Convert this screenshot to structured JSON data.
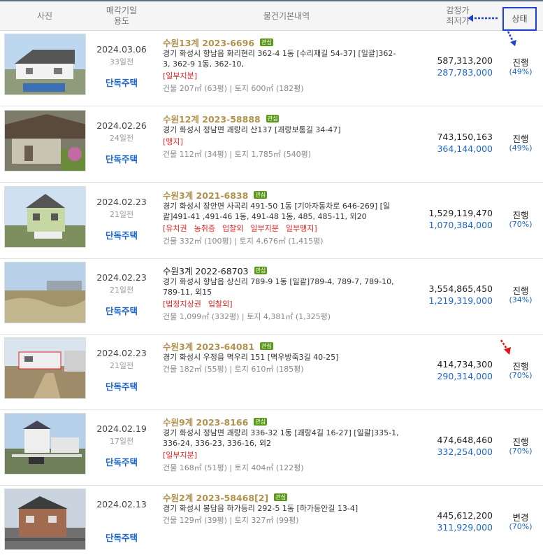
{
  "header": {
    "photo": "사진",
    "date_l1": "매각기일",
    "date_l2": "용도",
    "info": "물건기본내역",
    "price_l1": "감정가",
    "price_l2": "최저가",
    "status": "상태"
  },
  "colors": {
    "accent": "#1e66c9",
    "case_gold": "#b0924e",
    "warn_red": "#e02424",
    "badge_green": "#5b9a17",
    "status_box": "#1f3fd9"
  },
  "rows": [
    {
      "photo_icon": "house-photo",
      "date": "2024.03.06",
      "days": "33일전",
      "usage": "단독주택",
      "case": "수원13계 2023-6696",
      "badge": "관심",
      "addr1": "경기 화성시 향남읍 화리현리 362-4 1동 [수리재길 54-37]  [일괄]362-",
      "addr2": "3, 362-9 1동, 362-10,",
      "tags": [
        "[일부지분]"
      ],
      "area": "건물 207㎡ (63평)   |   토지 600㎡ (182평)",
      "appraise": "587,313,200",
      "min": "287,783,000",
      "status": "진행",
      "pct": "(49%)"
    },
    {
      "photo_icon": "house-photo",
      "date": "2024.02.26",
      "days": "24일전",
      "usage": "단독주택",
      "case": "수원12계 2023-58888",
      "badge": "관심",
      "addr1": "경기 화성시 정남면 괘랑리 산137 [괘랑보통길 34-47]",
      "addr2": "",
      "tags": [
        "[맹지]"
      ],
      "area": "건물 112㎡ (34평)   |   토지 1,785㎡ (540평)",
      "appraise": "743,150,163",
      "min": "364,144,000",
      "status": "진행",
      "pct": "(49%)"
    },
    {
      "photo_icon": "house-photo",
      "date": "2024.02.23",
      "days": "21일전",
      "usage": "단독주택",
      "case": "수원3계 2021-6838",
      "badge": "관심",
      "addr1": "경기 화성시 장안면 사곡리 491-50 1동 [기아자동차로 646-269]  [일",
      "addr2": "괄]491-41 ,491-46 1동, 491-48 1동, 485, 485-11, 외20",
      "tags": [
        "[유치권",
        "농취증",
        "입찰외",
        "일부지분",
        "일부맹지]"
      ],
      "area": "건물 332㎡ (100평)   |   토지 4,676㎡ (1,415평)",
      "appraise": "1,529,119,470",
      "min": "1,070,384,000",
      "status": "진행",
      "pct": "(70%)"
    },
    {
      "photo_icon": "land-photo",
      "date": "2024.02.23",
      "days": "21일전",
      "usage": "단독주택",
      "case": "수원3계 2022-68703",
      "badge": "관심",
      "case_dark": true,
      "addr1": "경기 화성시 향남읍 상신리 789-9 1동  [일괄]789-4, 789-7, 789-10,",
      "addr2": "789-11, 외15",
      "tags": [
        "[법정지상권",
        "입찰외]"
      ],
      "area": "건물 1,099㎡ (332평)   |   토지 4,381㎡ (1,325평)",
      "appraise": "3,554,865,450",
      "min": "1,219,319,000",
      "status": "진행",
      "pct": "(34%)"
    },
    {
      "photo_icon": "house-photo",
      "date": "2024.02.23",
      "days": "21일전",
      "usage": "단독주택",
      "case": "수원3계 2023-64081",
      "badge": "관심",
      "addr1": "경기 화성시 우정읍 멱우리 151 [멱우방죽3길 40-25]",
      "addr2": "",
      "tags": [],
      "area": "건물 182㎡ (55평)   |   토지 610㎡ (185평)",
      "appraise": "414,734,300",
      "min": "290,314,000",
      "status": "진행",
      "pct": "(70%)"
    },
    {
      "photo_icon": "house-photo",
      "date": "2024.02.19",
      "days": "17일전",
      "usage": "단독주택",
      "case": "수원9계 2023-8166",
      "badge": "관심",
      "addr1": "경기 화성시 정남면 괘랑리 336-32 1동 [괘랑4길 16-27]  [일괄]335-1,",
      "addr2": "336-24, 336-23, 336-16, 외2",
      "tags": [
        "[일부지분]"
      ],
      "area": "건물 168㎡ (51평)   |   토지 404㎡ (122평)",
      "appraise": "474,648,460",
      "min": "332,254,000",
      "status": "진행",
      "pct": "(70%)"
    },
    {
      "photo_icon": "house-photo",
      "date": "2024.02.13",
      "days": "",
      "usage": "단독주택",
      "case": "수원2계 2023-58468[2]",
      "badge": "관심",
      "addr1": "경기 화성시 봉담읍 하가등리 292-5 1동 [하가등안길 13-4]",
      "addr2": "",
      "tags": [],
      "area": "건물 129㎡ (39평)   |   토지 327㎡ (99평)",
      "appraise": "445,612,200",
      "min": "311,929,000",
      "status": "변경",
      "pct": "(70%)"
    }
  ]
}
